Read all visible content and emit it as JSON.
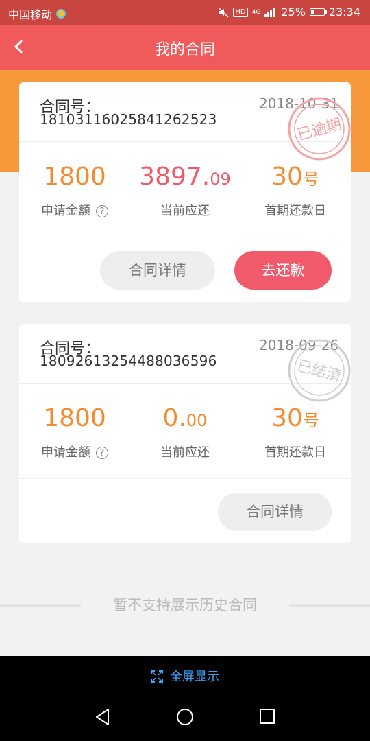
{
  "status_bar": {
    "carrier": "中国移动",
    "hd": "HD",
    "network": "4G",
    "battery": "25%",
    "battery_level": 0.25,
    "time": "23:34"
  },
  "header": {
    "title": "我的合同"
  },
  "contracts": [
    {
      "label": "合同号：",
      "number": "181031160258412625​23",
      "date": "2018-10-31",
      "stamp": "已逾期",
      "amount": "1800",
      "amount_label": "申请金额",
      "due_main": "3897.",
      "due_cents": "09",
      "due_label": "当前应还",
      "pay_day": "30",
      "pay_day_unit": "号",
      "pay_day_label": "首期还款日",
      "detail_button": "合同详情",
      "repay_button": "去还款"
    },
    {
      "label": "合同号：",
      "number": "180926132544880365​96",
      "date": "2018-09-26",
      "stamp": "已结清",
      "amount": "1800",
      "amount_label": "申请金额",
      "due_main": "0.",
      "due_cents": "00",
      "due_label": "当前应还",
      "pay_day": "30",
      "pay_day_unit": "号",
      "pay_day_label": "首期还款日",
      "detail_button": "合同详情"
    }
  ],
  "footer_note": "暂不支持展示历史合同",
  "fullscreen_label": "全屏显示",
  "colors": {
    "header": "#f05a5a",
    "accent_orange": "#f28c2f",
    "accent_red": "#f05a6a"
  }
}
